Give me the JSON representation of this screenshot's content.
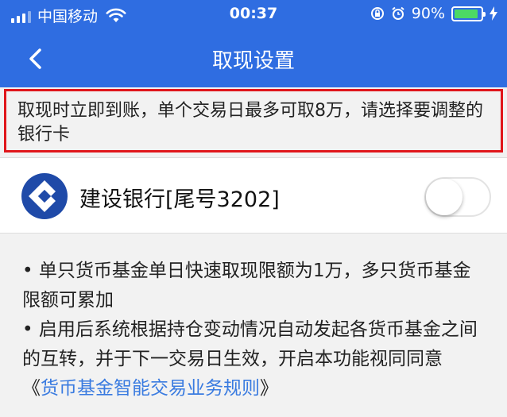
{
  "status_bar": {
    "carrier": "中国移动",
    "time": "00:37",
    "battery": "90%",
    "battery_level": 0.9
  },
  "nav": {
    "title": "取现设置",
    "back_icon": "chevron-left-icon"
  },
  "notice": {
    "text": "取现时立即到账，单个交易日最多可取8万，请选择要调整的银行卡"
  },
  "bank": {
    "name": "建设银行[尾号3202]",
    "logo_icon": "ccb-bank-logo",
    "toggle_on": false
  },
  "rules": {
    "line1": "• 单只货币基金单日快速取现限额为1万，多只货币基金限额可累加",
    "line2_prefix": "• 启用后系统根据持仓变动情况自动发起各货币基金之间的互转，并于下一交易日生效，开启本功能视同同意《",
    "line2_link": "货币基金智能交易业务规则",
    "line2_suffix": "》"
  },
  "colors": {
    "primary": "#2f6de1",
    "highlight_border": "#e0161b",
    "link": "#3a7be0",
    "battery": "#4cd964"
  }
}
